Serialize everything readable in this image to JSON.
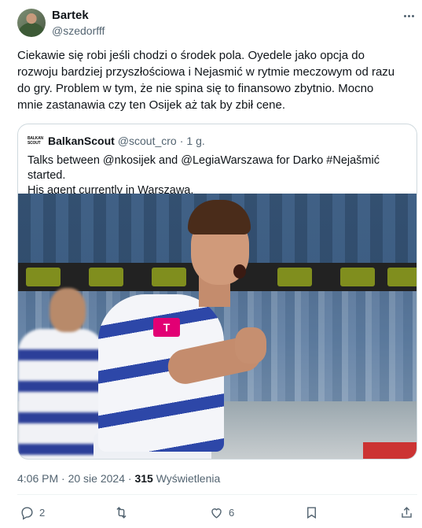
{
  "author": {
    "name": "Bartek",
    "handle": "@szedorfff"
  },
  "tweet": {
    "text": "Ciekawie się robi jeśli chodzi o środek pola. Oyedele jako opcja do\nrozwoju bardziej przyszłościowa i Nejasmić w rytmie meczowym od razu\ndo gry. Problem w tym, że nie spina się to finansowo zbytnio. Mocno\nmnie zastanawia czy ten Osijek aż tak by zbił cene."
  },
  "quote": {
    "logo_text_line1": "BALKAN",
    "logo_text_line2": "SCOUT",
    "name": "BalkanScout",
    "handle": "@scout_cro",
    "separator": "·",
    "time": "1 g.",
    "text": "Talks between @nkosijek and @LegiaWarszawa for Darko #Nejašmić started.\nHis agent currently in Warszawa.",
    "photo_sponsor": "T"
  },
  "meta": {
    "time": "4:06 PM",
    "separator": "·",
    "date": "20 sie 2024",
    "views_count": "315",
    "views_label": "Wyświetlenia"
  },
  "actions": {
    "replies": "2",
    "likes": "6"
  },
  "icons": [
    "more-icon",
    "reply-icon",
    "retweet-icon",
    "like-icon",
    "bookmark-icon",
    "share-icon"
  ]
}
